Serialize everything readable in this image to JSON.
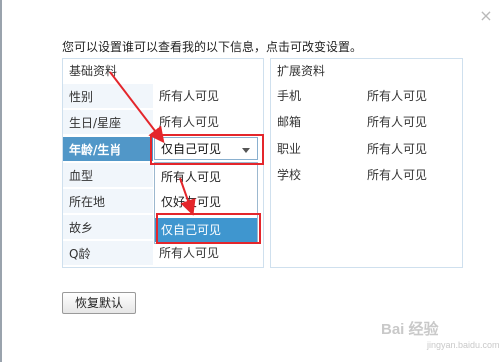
{
  "dialog": {
    "instruction": "您可以设置谁可以查看我的以下信息，点击可改变设置。",
    "reset_label": "恢复默认",
    "close_glyph": "×"
  },
  "basic": {
    "title": "基础资料",
    "rows": [
      {
        "label": "性别",
        "value": "所有人可见"
      },
      {
        "label": "生日/星座",
        "value": "所有人可见"
      },
      {
        "label": "年龄/生肖",
        "value": ""
      },
      {
        "label": "血型",
        "value": ""
      },
      {
        "label": "所在地",
        "value": ""
      },
      {
        "label": "故乡",
        "value": ""
      },
      {
        "label": "Q龄",
        "value": "所有人可见"
      }
    ]
  },
  "extended": {
    "title": "扩展资料",
    "rows": [
      {
        "label": "手机",
        "value": "所有人可见"
      },
      {
        "label": "邮箱",
        "value": "所有人可见"
      },
      {
        "label": "职业",
        "value": "所有人可见"
      },
      {
        "label": "学校",
        "value": "所有人可见"
      }
    ]
  },
  "dropdown": {
    "selected": "仅自己可见",
    "options": [
      "所有人可见",
      "仅好友可见",
      "仅自己可见"
    ],
    "highlighted_index": 2
  },
  "annotation_color": "#e4262b",
  "highlight_color": "#3f96cf",
  "watermark": {
    "main": "Bai 经验",
    "sub": "jingyan.baidu.com"
  }
}
